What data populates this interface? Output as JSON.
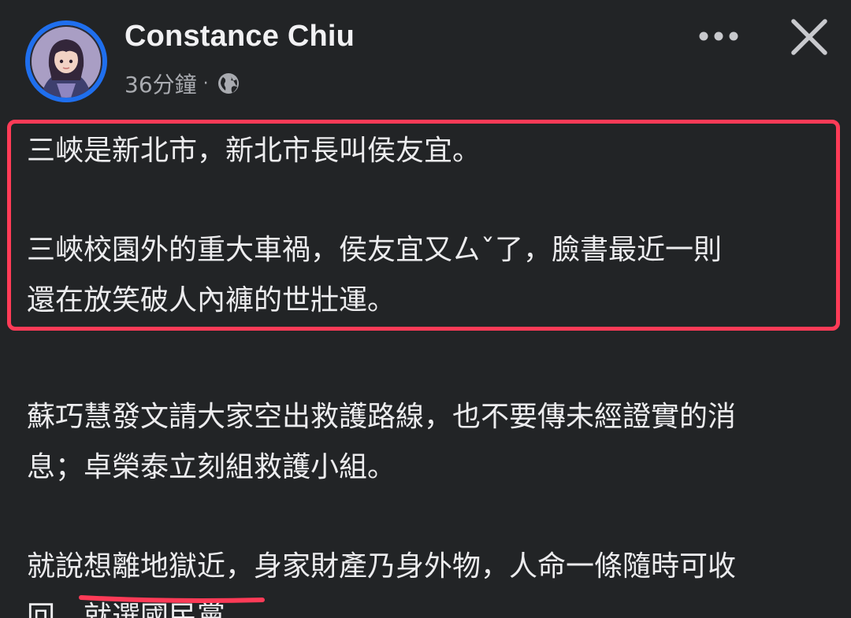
{
  "header": {
    "author_name": "Constance Chiu",
    "timestamp": "36分鐘",
    "separator": "·",
    "privacy_icon": "globe-icon",
    "more_icon": "more-options-icon",
    "close_icon": "close-icon"
  },
  "post": {
    "lines": [
      "三峽是新北市，新北市長叫侯友宜。",
      "三峽校園外的重大車禍，侯友宜又ㄙˇ了，臉書最近一則",
      "還在放笑破人內褲的世壯運。",
      "蘇巧慧發文請大家空出救護路線，也不要傳未經證實的消",
      "息；卓榮泰立刻組救護小組。",
      "就說想離地獄近，身家財產乃身外物，人命一條隨時可收"
    ],
    "last_line_start": "回，",
    "last_line_underlined": "就選國民黨",
    "last_line_end": "。"
  },
  "colors": {
    "background": "#222426",
    "text": "#ececee",
    "secondary_text": "#a9abb0",
    "avatar_ring": "#1f6fee",
    "annotation_red": "#ff3b57"
  }
}
